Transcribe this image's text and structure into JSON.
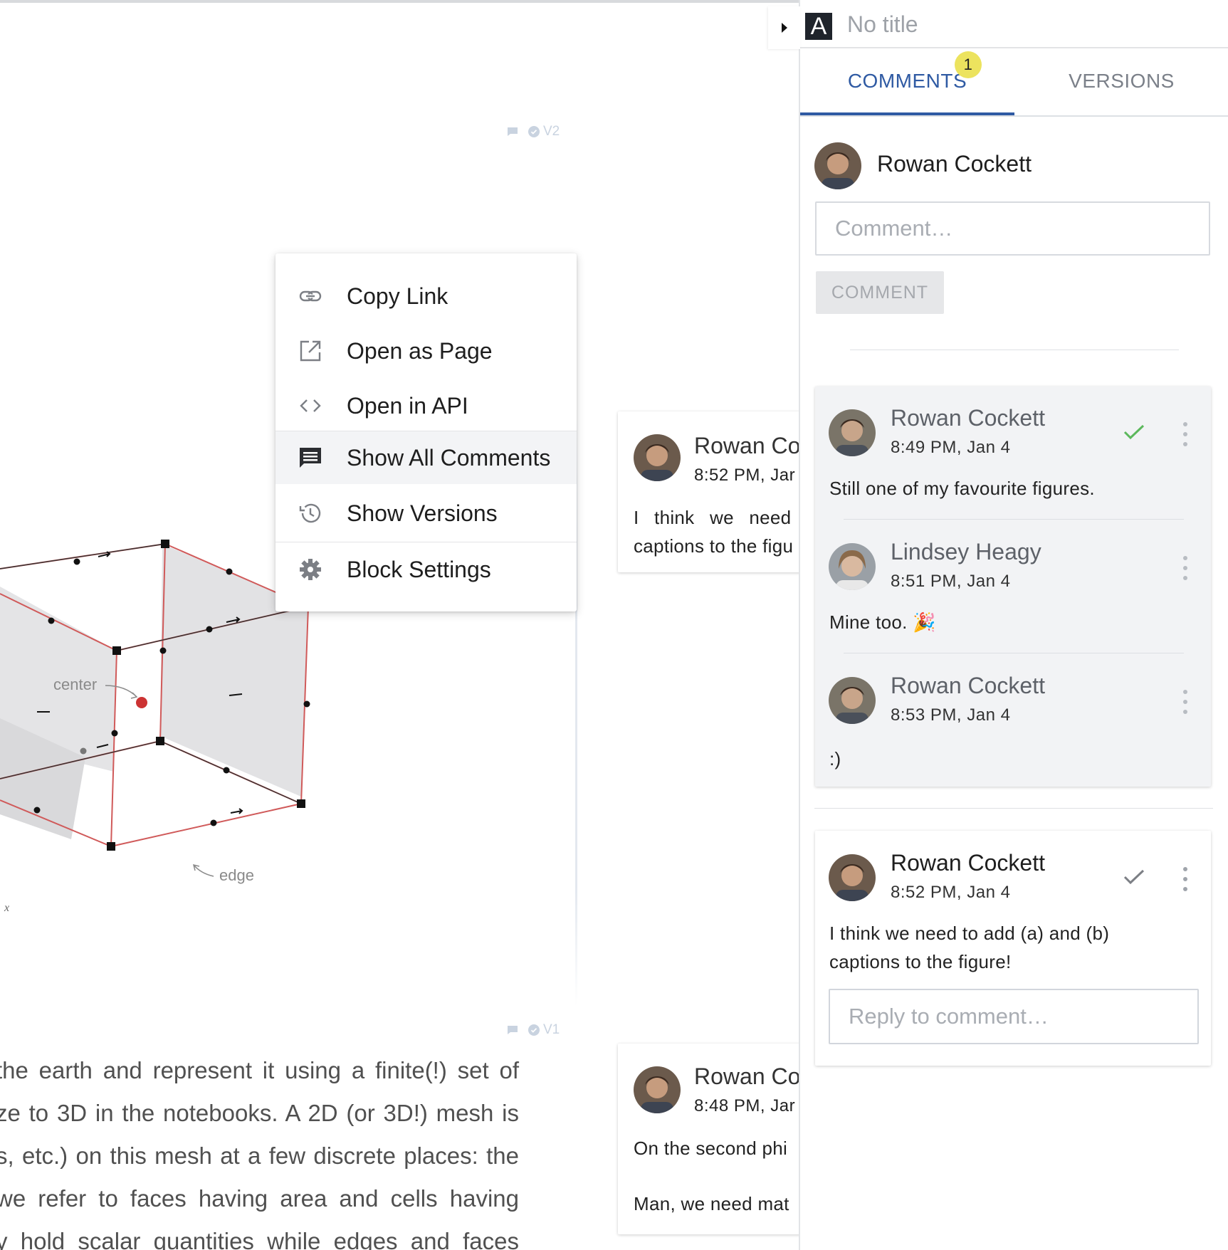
{
  "panel": {
    "doc_badge": "A",
    "doc_title": "No title",
    "tabs": [
      {
        "label": "COMMENTS",
        "active": true,
        "badge": "1"
      },
      {
        "label": "VERSIONS",
        "active": false
      }
    ],
    "current_user": "Rowan Cockett",
    "comment_placeholder": "Comment…",
    "comment_button": "COMMENT",
    "threads": [
      {
        "comments": [
          {
            "author": "Rowan Cockett",
            "time": "8:49 PM, Jan 4",
            "text": "Still one of my favourite figures.",
            "resolved": true
          },
          {
            "author": "Lindsey Heagy",
            "time": "8:51 PM, Jan 4",
            "text": "Mine too.",
            "emoji": "🎉"
          },
          {
            "author": "Rowan Cockett",
            "time": "8:53 PM, Jan 4",
            "text": ":)"
          }
        ]
      },
      {
        "comments": [
          {
            "author": "Rowan Cockett",
            "time": "8:52 PM, Jan 4",
            "text_lines": [
              "I think we need to add (a) and (b)",
              "captions to the figure!"
            ],
            "resolved": false
          }
        ],
        "reply_placeholder": "Reply to comment…"
      }
    ],
    "colors": {
      "accent": "#2f5aa3",
      "badge": "#ece35e",
      "resolved_check": "#5cb85c"
    }
  },
  "menu": {
    "items": [
      {
        "label": "Copy Link",
        "icon": "link-icon"
      },
      {
        "label": "Open as Page",
        "icon": "open-external-icon"
      },
      {
        "label": "Open in API",
        "icon": "code-icon"
      },
      {
        "label": "Show All Comments",
        "icon": "comment-icon",
        "active": true
      },
      {
        "label": "Show Versions",
        "icon": "history-icon"
      },
      {
        "label": "Block Settings",
        "icon": "gear-icon"
      }
    ]
  },
  "doc": {
    "block_versions": [
      "V2",
      "V1"
    ],
    "figure_labels": {
      "center": "center",
      "edge": "edge",
      "axis": "x"
    },
    "paragraph": [
      "the earth and represent it using a finite(!) set of",
      "ze to 3D in the notebooks. A 2D (or 3D!) mesh is",
      "s, etc.) on this mesh at a few discrete places: the",
      " we refer to faces having area and cells having",
      "y hold scalar quantities while edges and faces"
    ],
    "inline_comments": [
      {
        "author": "Rowan Co",
        "time": "8:52 PM, Jar",
        "lines": [
          "I think we need",
          "captions to the figu"
        ]
      },
      {
        "author": "Rowan Co",
        "time": "8:48 PM, Jar",
        "lines": [
          "On the second phi",
          "Man, we need mat"
        ]
      }
    ]
  }
}
